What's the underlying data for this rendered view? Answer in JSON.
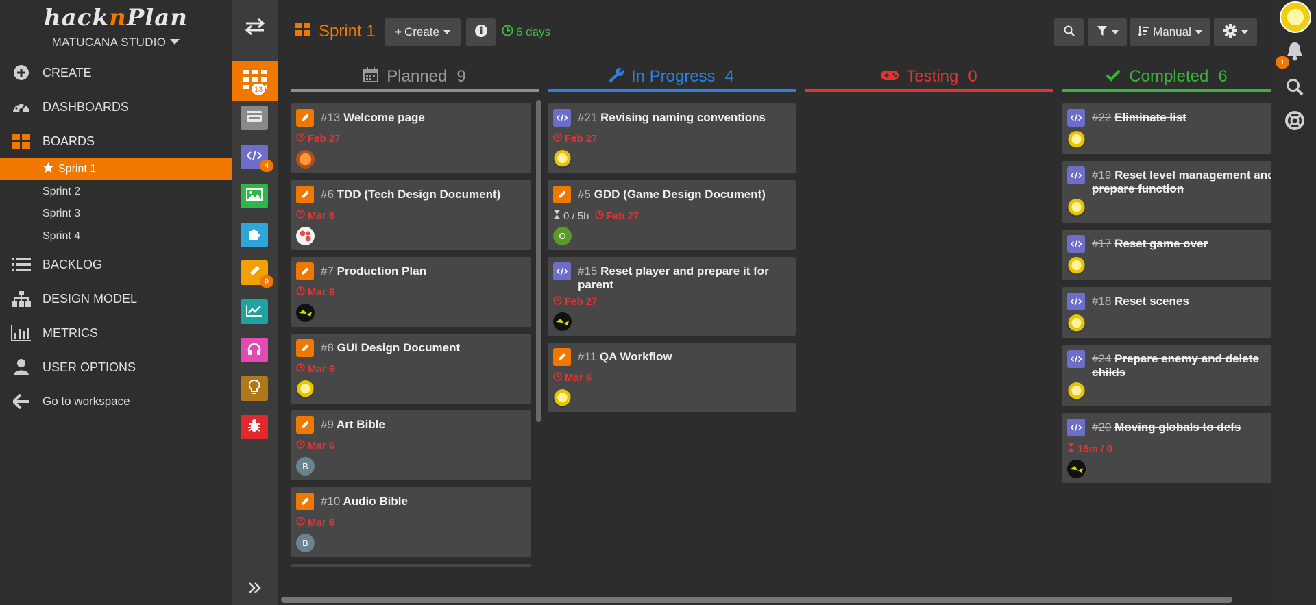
{
  "app": {
    "logo_pre": "hack",
    "logo_n": "n",
    "logo_post": "Plan",
    "studio": "MATUCANA STUDIO"
  },
  "nav": {
    "create": "CREATE",
    "dashboards": "DASHBOARDS",
    "boards": "BOARDS",
    "sprints": [
      "Sprint 1",
      "Sprint 2",
      "Sprint 3",
      "Sprint 4"
    ],
    "backlog": "BACKLOG",
    "design_model": "DESIGN MODEL",
    "metrics": "METRICS",
    "user_options": "USER OPTIONS",
    "workspace": "Go to workspace"
  },
  "strip": {
    "badges": {
      "all": "13",
      "programming": "4",
      "writing": "9"
    },
    "buttons": [
      {
        "name": "all-tasks",
        "color": "#f07800"
      },
      {
        "name": "general",
        "color": "#8a8a8a"
      },
      {
        "name": "programming",
        "color": "#6c6ec9"
      },
      {
        "name": "art",
        "color": "#2fb84a"
      },
      {
        "name": "game-design",
        "color": "#2fa6d9"
      },
      {
        "name": "writing",
        "color": "#f0a000"
      },
      {
        "name": "marketing",
        "color": "#1ea2a2"
      },
      {
        "name": "audio",
        "color": "#e24ab4"
      },
      {
        "name": "ideas",
        "color": "#b07818"
      },
      {
        "name": "bugs",
        "color": "#e0282d"
      }
    ]
  },
  "toolbar": {
    "sprint_title": "Sprint 1",
    "create_label": "Create",
    "days_left": "6 days",
    "sort_label": "Manual"
  },
  "columns": {
    "planned": {
      "label": "Planned",
      "count": "9",
      "color": "#8e8e8e"
    },
    "in_progress": {
      "label": "In Progress",
      "count": "4",
      "color": "#2d7fe0"
    },
    "testing": {
      "label": "Testing",
      "count": "0",
      "color": "#e03535"
    },
    "completed": {
      "label": "Completed",
      "count": "6",
      "color": "#39b339"
    }
  },
  "cards": {
    "planned": [
      {
        "num": "#13",
        "title": "Welcome page",
        "date": "Feb 27"
      },
      {
        "num": "#6",
        "title": "TDD (Tech Design Document)",
        "date": "Mar 6"
      },
      {
        "num": "#7",
        "title": "Production Plan",
        "date": "Mar 6"
      },
      {
        "num": "#8",
        "title": "GUI Design Document",
        "date": "Mar 6"
      },
      {
        "num": "#9",
        "title": "Art Bible",
        "date": "Mar 6",
        "avatar": "B"
      },
      {
        "num": "#10",
        "title": "Audio Bible",
        "date": "Mar 6",
        "avatar": "B"
      }
    ],
    "in_progress": [
      {
        "num": "#21",
        "title": "Revising naming conventions",
        "date": "Feb 27"
      },
      {
        "num": "#5",
        "title": "GDD (Game Design Document)",
        "estimate": "0 / 5h",
        "date": "Feb 27",
        "avatar": "O"
      },
      {
        "num": "#15",
        "title": "Reset player and prepare it for parent",
        "date": "Feb 27"
      },
      {
        "num": "#11",
        "title": "QA Workflow",
        "date": "Mar 6"
      }
    ],
    "completed": [
      {
        "num": "#22",
        "title": "Eliminate list"
      },
      {
        "num": "#19",
        "title": "Reset level management and prepare function"
      },
      {
        "num": "#17",
        "title": "Reset game over"
      },
      {
        "num": "#18",
        "title": "Reset scenes"
      },
      {
        "num": "#24",
        "title": "Prepare enemy and delete childs"
      },
      {
        "num": "#20",
        "title": "Moving globals to defs",
        "estimate": "15m / 0"
      }
    ]
  },
  "rail": {
    "notifications": "1"
  }
}
